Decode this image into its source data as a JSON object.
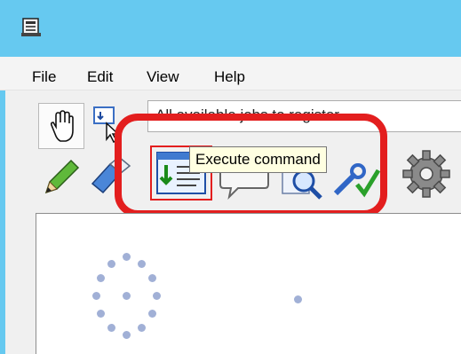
{
  "menu": {
    "items": [
      {
        "label": "File"
      },
      {
        "label": "Edit"
      },
      {
        "label": "View"
      },
      {
        "label": "Help"
      }
    ]
  },
  "tools": {
    "items": [
      {
        "icon": "hand-icon",
        "pressed": true
      },
      {
        "icon": "select-icon",
        "pressed": false
      },
      {
        "icon": "pencil-icon",
        "pressed": false
      },
      {
        "icon": "eraser-icon",
        "pressed": false
      }
    ]
  },
  "combo": {
    "value": "All available jobs to register"
  },
  "toolbar": {
    "icons": [
      "execute-command-icon",
      "speech-bubble-icon",
      "search-icon",
      "check-tools-icon",
      "gear-icon"
    ]
  },
  "tooltip": {
    "text": "Execute command"
  },
  "colors": {
    "titlebar": "#66c9f0",
    "highlight": "#e31e1e",
    "tooltip_bg": "#ffffe1",
    "spinner": "#a1b0d6"
  }
}
